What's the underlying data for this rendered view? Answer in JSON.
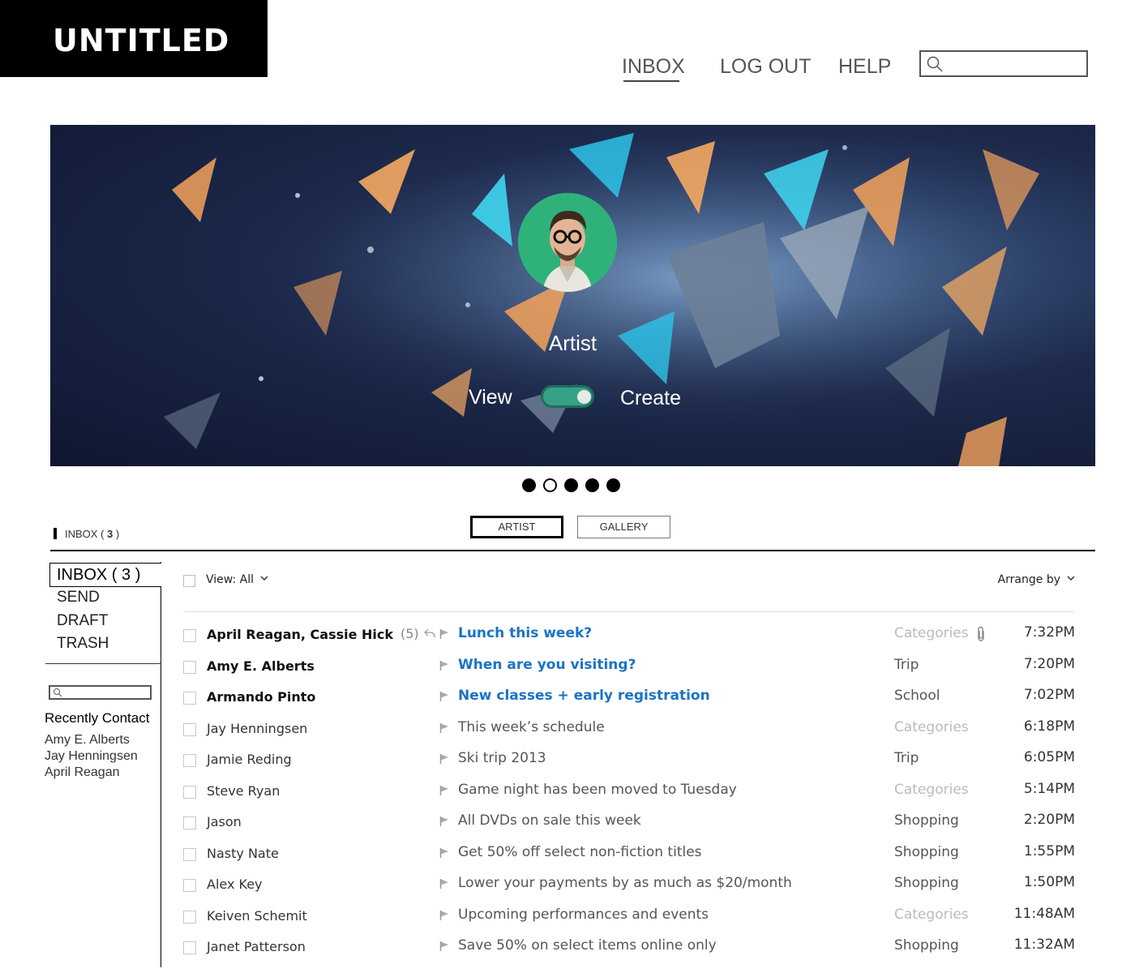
{
  "app": {
    "logo": "UNTITLED"
  },
  "nav": {
    "inbox": "INBOX",
    "logout": "LOG OUT",
    "help": "HELP",
    "search_placeholder": ""
  },
  "hero": {
    "name": "Artist",
    "toggle_left": "View",
    "toggle_right": "Create",
    "toggle_on": true
  },
  "carousel": {
    "total": 5,
    "active_index": 1
  },
  "tabs": {
    "inbox_label": "INBOX ( ",
    "inbox_count": "3",
    "inbox_close": " )",
    "artist": "ARTIST",
    "gallery": "GALLERY"
  },
  "sidebar": {
    "items": [
      {
        "label": "INBOX ( 3 )"
      },
      {
        "label": "SEND"
      },
      {
        "label": "DRAFT"
      },
      {
        "label": "TRASH"
      }
    ],
    "search_placeholder": "",
    "recent_title": "Recently Contact",
    "recent": [
      "Amy E. Alberts",
      "Jay Henningsen",
      "April Reagan"
    ]
  },
  "list": {
    "view_label": "View: All",
    "arrange_label": "Arrange by",
    "messages": [
      {
        "from": "April Reagan,  Cassie Hick",
        "count": "(5)",
        "subject": "Lunch this week?",
        "category": "Categories",
        "time": "7:32PM",
        "unread": true
      },
      {
        "from": "Amy E. Alberts",
        "count": "",
        "subject": "When are you visiting?",
        "category": "Trip",
        "time": "7:20PM",
        "unread": true
      },
      {
        "from": "Armando Pinto",
        "count": "",
        "subject": "New classes + early registration",
        "category": "School",
        "time": "7:02PM",
        "unread": true
      },
      {
        "from": "Jay Henningsen",
        "count": "",
        "subject": "This week’s schedule",
        "category": "Categories",
        "time": "6:18PM",
        "unread": false
      },
      {
        "from": "Jamie Reding",
        "count": "",
        "subject": "Ski trip 2013",
        "category": "Trip",
        "time": "6:05PM",
        "unread": false
      },
      {
        "from": "Steve Ryan",
        "count": "",
        "subject": "Game night has been moved to Tuesday",
        "category": "Categories",
        "time": "5:14PM",
        "unread": false
      },
      {
        "from": "Jason",
        "count": "",
        "subject": "All DVDs on sale this week",
        "category": "Shopping",
        "time": "2:20PM",
        "unread": false
      },
      {
        "from": "Nasty Nate",
        "count": "",
        "subject": "Get 50% off select non-fiction titles",
        "category": "Shopping",
        "time": "1:55PM",
        "unread": false
      },
      {
        "from": "Alex Key",
        "count": "",
        "subject": "Lower your payments by as much as $20/month",
        "category": "Shopping",
        "time": "1:50PM",
        "unread": false
      },
      {
        "from": "Keiven Schemit",
        "count": "",
        "subject": "Upcoming performances and events",
        "category": "Categories",
        "time": "11:48AM",
        "unread": false
      },
      {
        "from": "Janet Patterson",
        "count": "",
        "subject": "Save 50% on select items online only",
        "category": "Shopping",
        "time": "11:32AM",
        "unread": false
      }
    ]
  },
  "colors": {
    "accent": "#1a73c5",
    "toggle": "#37a187",
    "muted": "#bbbbbb"
  }
}
